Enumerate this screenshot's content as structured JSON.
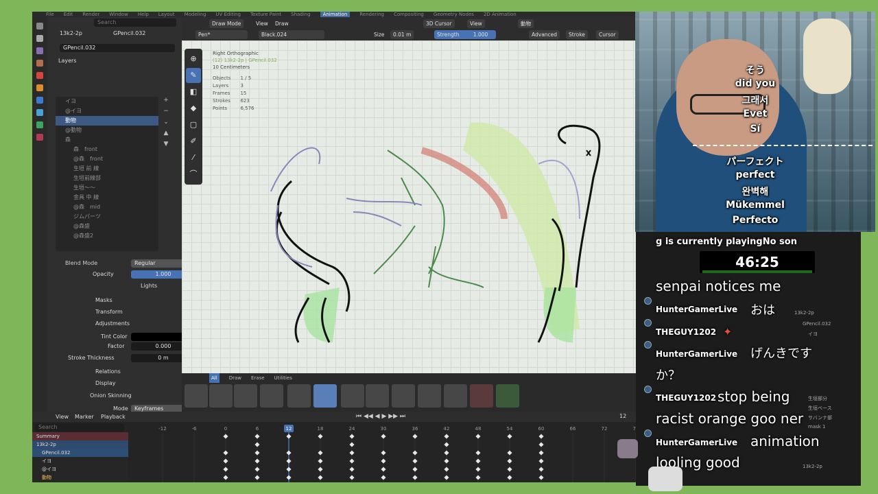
{
  "topbar": {
    "tabs": [
      "File",
      "Edit",
      "Render",
      "Window",
      "Help",
      "Layout",
      "Modeling",
      "UV Editing",
      "Texture Paint",
      "Shading",
      "Animation",
      "Rendering",
      "Compositing",
      "Geometry Nodes",
      "2D Animation"
    ],
    "active_tab": "Animation"
  },
  "props": {
    "search_placeholder": "Search",
    "breadcrumb_scene": "13k2-2p",
    "breadcrumb_obj": "GPencil.032",
    "data_name": "GPencil.032",
    "section_layers": "Layers",
    "layers": [
      "イヨ",
      "@イヨ",
      "動物",
      "@動物",
      "森",
      "森　front",
      "@森　front",
      "生垣 前 線",
      "生垣前線部",
      "生垣〜〜",
      "金具 中 線",
      "@森　mid",
      "ジムパーツ",
      "@森盛",
      "@森盛2"
    ],
    "selected_layer": "動物",
    "blend_mode_label": "Blend Mode",
    "blend_mode_value": "Regular",
    "opacity_label": "Opacity",
    "opacity_value": "1.000",
    "lights_label": "Lights",
    "masks_label": "Masks",
    "transform_label": "Transform",
    "adjustments_label": "Adjustments",
    "tint_label": "Tint Color",
    "factor_label": "Factor",
    "factor_value": "0.000",
    "thickness_label": "Stroke Thickness",
    "thickness_value": "0 m",
    "relations_label": "Relations",
    "display_label": "Display",
    "onion_label": "Onion Skinning",
    "mode_label": "Mode",
    "mode_value": "Keyframes",
    "opacity2_label": "Opacity",
    "opacity2_value": "1.000"
  },
  "header": {
    "mode": "Draw Mode",
    "view": "View",
    "draw": "Draw",
    "cursor_label": "3D Cursor",
    "view_dd": "View",
    "object_name": "動物",
    "brush": "Pen*",
    "material": "Black.024",
    "size_label": "Size",
    "size_value": "0.01 m",
    "strength_label": "Strength",
    "strength_value": "1.000",
    "advanced": "Advanced",
    "stroke": "Stroke",
    "cursor": "Cursor"
  },
  "overlay": {
    "view": "Right Orthographic",
    "path": "(12) 13k2-2p | GPencil.032",
    "scale": "10 Centimeters",
    "stats": [
      [
        "Objects",
        "1 / 5"
      ],
      [
        "Layers",
        "3"
      ],
      [
        "Frames",
        "15"
      ],
      [
        "Strokes",
        "623"
      ],
      [
        "Points",
        "6,576"
      ]
    ]
  },
  "asset": {
    "tabs": [
      "All",
      "Draw",
      "Erase",
      "Utilities"
    ],
    "active": "All"
  },
  "timeline": {
    "menus": [
      "View",
      "Marker",
      "Playback"
    ],
    "search_placeholder": "Search",
    "ticks": [
      "-12",
      "-6",
      "0",
      "6",
      "12",
      "18",
      "24",
      "30",
      "36",
      "42",
      "48",
      "54",
      "60",
      "66",
      "72",
      "78"
    ],
    "current_frame": "12",
    "channels": [
      "Summary",
      "13k2-2p",
      "GPencil.032",
      "イヨ",
      "@イヨ",
      "動物"
    ]
  },
  "captions": [
    "そう",
    "did you",
    "그래서",
    "Evet",
    "Sí",
    "パーフェクト",
    "perfect",
    "완벽해",
    "Mükemmel",
    "Perfecto"
  ],
  "chat": {
    "playing": "g is currently playingNo son",
    "timer": "46:25",
    "lines": [
      {
        "user": "",
        "msg": "senpai notices me"
      },
      {
        "user": "HunterGamerLive",
        "msg": "おは"
      },
      {
        "user": "THEGUY1202",
        "msg": ""
      },
      {
        "user": "HunterGamerLive",
        "msg": "げんきです"
      },
      {
        "user": "",
        "msg": "か？"
      },
      {
        "user": "THEGUY1202",
        "msg": "stop being"
      },
      {
        "user": "",
        "msg": "racist orange goo ner"
      },
      {
        "user": "HunterGamerLive",
        "msg": "animation"
      },
      {
        "user": "",
        "msg": "looling good"
      }
    ]
  },
  "right_panel": {
    "items": [
      "13k2-2p",
      "GPencil.032",
      "イヨ",
      "生垣部分",
      "生垣ベース",
      "サバンナ部",
      "mask 1",
      "13k2-2p"
    ]
  }
}
